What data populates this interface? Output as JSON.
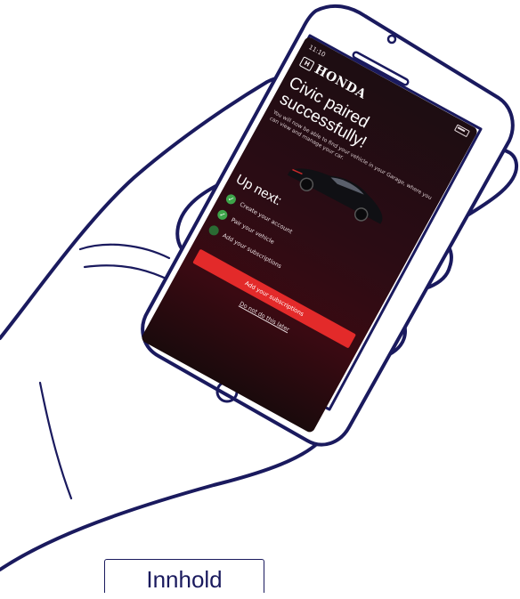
{
  "phone": {
    "time": "11:10",
    "brand": "HONDA",
    "title": "Civic paired successfully!",
    "subtitle": "You will now be able to find your vehicle in your Garage, where you can view and manage your car.",
    "up_next": "Up next:",
    "steps": [
      {
        "label": "Create your account",
        "done": true
      },
      {
        "label": "Pair your vehicle",
        "done": true
      },
      {
        "label": "Add your subscriptions",
        "done": false
      }
    ],
    "cta_label": "Add your subscriptions",
    "skip_label": "Do not do this later"
  },
  "contents_tab": "Innhold",
  "colors": {
    "outline": "#1a1a5e",
    "screen_bg": "#2b0c14",
    "accent": "#e32a2a",
    "check": "#3ea54a"
  }
}
